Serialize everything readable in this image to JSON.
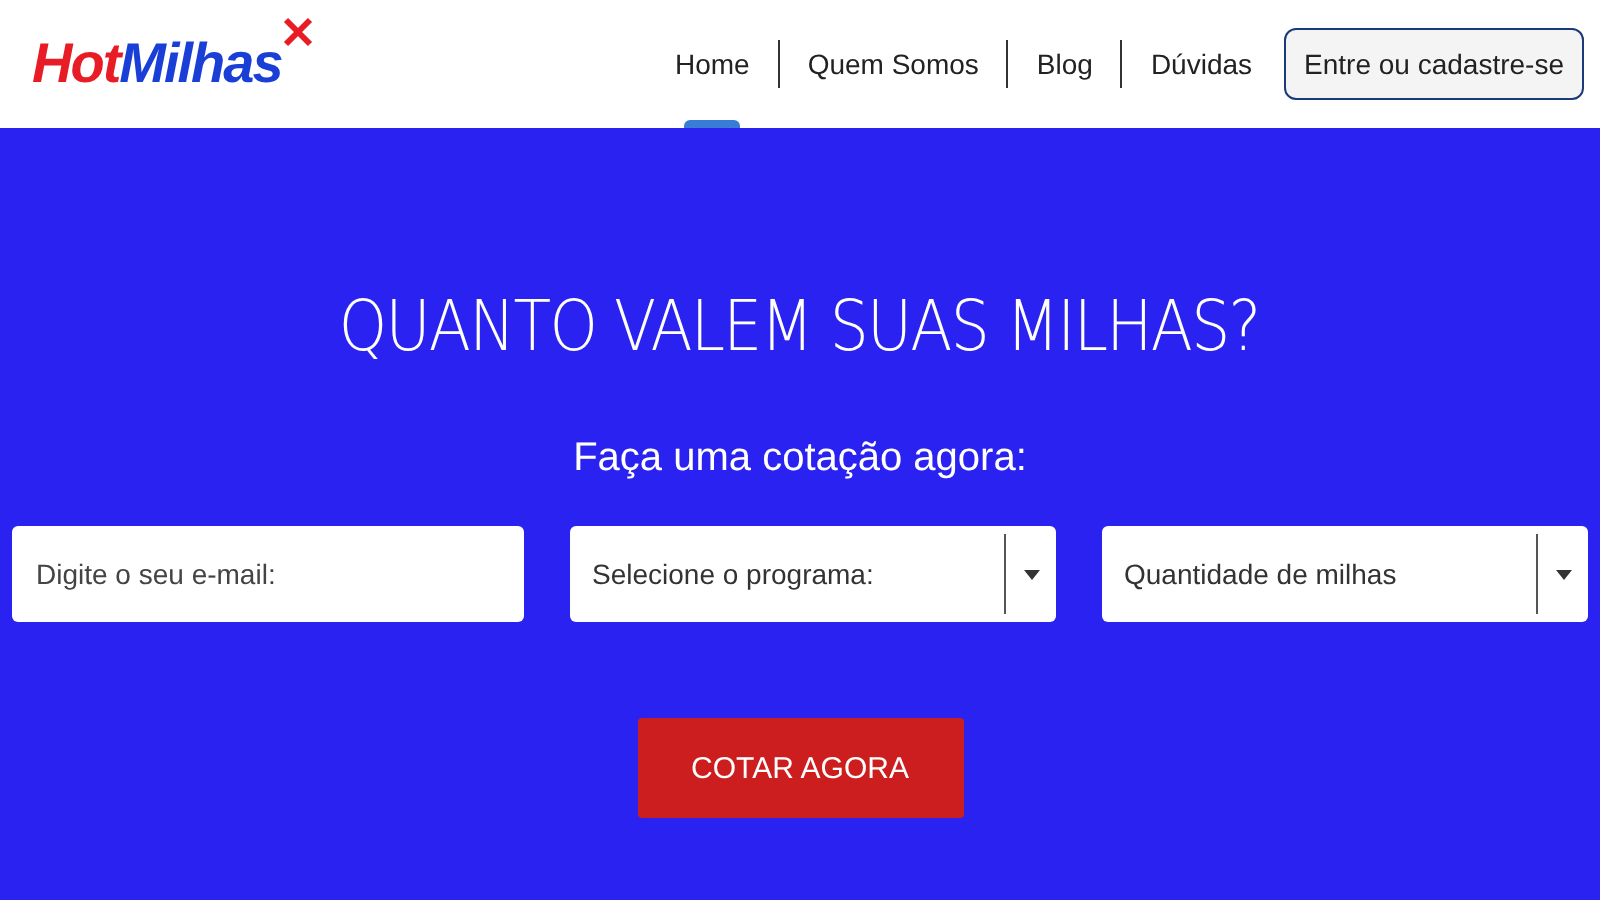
{
  "logo": {
    "part_1": "Hot",
    "part_2": "Milhas"
  },
  "nav": [
    {
      "label": "Home",
      "selected": true
    },
    {
      "label": "Quem Somos",
      "selected": false
    },
    {
      "label": "Blog",
      "selected": false
    },
    {
      "label": "Dúvidas",
      "selected": false
    }
  ],
  "login_button": "Entre ou cadastre-se",
  "hero": {
    "title": "QUANTO VALEM SUAS MILHAS?",
    "subtitle": "Faça uma cotação agora:",
    "fields": [
      {
        "kind": "input",
        "placeholder": "Digite o seu e-mail:"
      },
      {
        "kind": "select",
        "value": "Selecione o programa:"
      },
      {
        "kind": "select",
        "value": "Quantidade de milhas"
      }
    ],
    "submit": "COTAR AGORA"
  }
}
